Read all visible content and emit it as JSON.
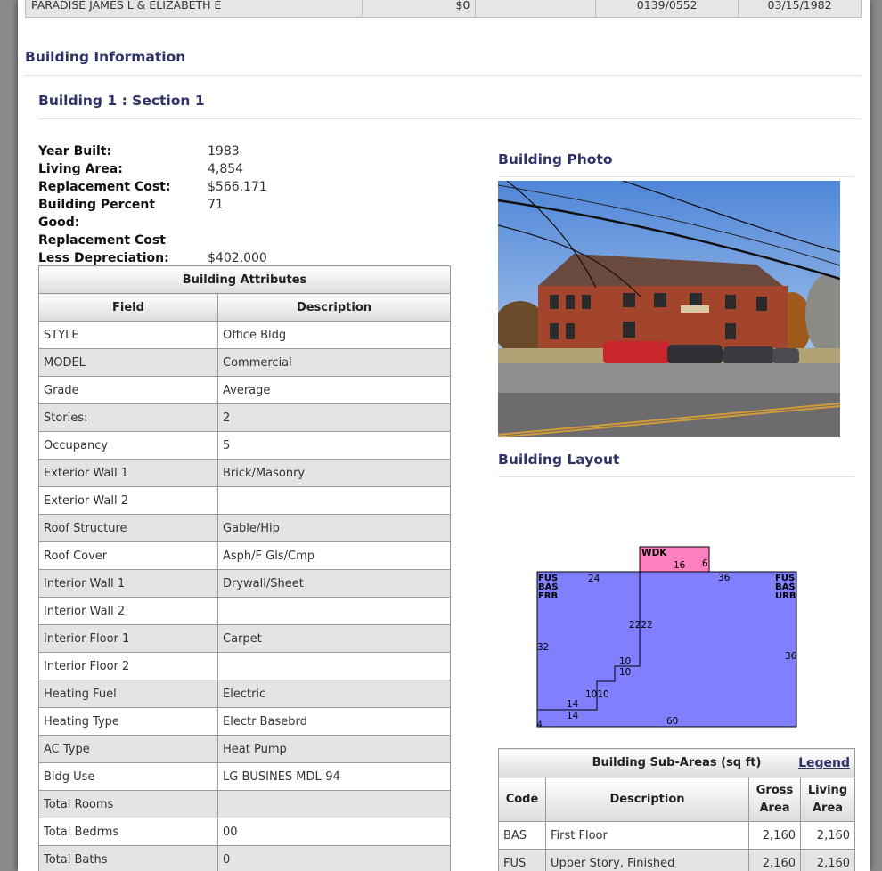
{
  "top_row": {
    "owner": "PARADISE JAMES L & ELIZABETH E",
    "price": "$0",
    "book_page": "0139/0552",
    "date": "03/15/1982"
  },
  "headings": {
    "building_info": "Building Information",
    "section": "Building 1 : Section 1",
    "photo": "Building Photo",
    "layout": "Building Layout"
  },
  "summary": [
    {
      "label": "Year Built:",
      "value": "1983"
    },
    {
      "label": "Living Area:",
      "value": "4,854"
    },
    {
      "label": "Replacement Cost:",
      "value": "$566,171"
    },
    {
      "label": "Building Percent",
      "value": "71"
    },
    {
      "label": "Good:",
      "value": ""
    },
    {
      "label": "Replacement Cost",
      "value": ""
    },
    {
      "label": "Less Depreciation:",
      "value": "$402,000"
    }
  ],
  "attributes": {
    "caption": "Building Attributes",
    "col_field": "Field",
    "col_desc": "Description",
    "rows": [
      {
        "field": "STYLE",
        "desc": "Office Bldg"
      },
      {
        "field": "MODEL",
        "desc": "Commercial"
      },
      {
        "field": "Grade",
        "desc": "Average"
      },
      {
        "field": "Stories:",
        "desc": "2"
      },
      {
        "field": "Occupancy",
        "desc": "5"
      },
      {
        "field": "Exterior Wall 1",
        "desc": "Brick/Masonry"
      },
      {
        "field": "Exterior Wall 2",
        "desc": ""
      },
      {
        "field": "Roof Structure",
        "desc": "Gable/Hip"
      },
      {
        "field": "Roof Cover",
        "desc": "Asph/F Gls/Cmp"
      },
      {
        "field": "Interior Wall 1",
        "desc": "Drywall/Sheet"
      },
      {
        "field": "Interior Wall 2",
        "desc": ""
      },
      {
        "field": "Interior Floor 1",
        "desc": "Carpet"
      },
      {
        "field": "Interior Floor 2",
        "desc": ""
      },
      {
        "field": "Heating Fuel",
        "desc": "Electric"
      },
      {
        "field": "Heating Type",
        "desc": "Electr Basebrd"
      },
      {
        "field": "AC Type",
        "desc": "Heat Pump"
      },
      {
        "field": "Bldg Use",
        "desc": "LG BUSINES MDL-94"
      },
      {
        "field": "Total Rooms",
        "desc": ""
      },
      {
        "field": "Total Bedrms",
        "desc": "00"
      },
      {
        "field": "Total Baths",
        "desc": "0"
      }
    ]
  },
  "layout_sketch": {
    "labels": {
      "wdk": "WDK",
      "left_block": [
        "FUS",
        "BAS",
        "FRB"
      ],
      "right_block": [
        "FUS",
        "BAS",
        "URB"
      ]
    },
    "dimensions": [
      "16",
      "6",
      "24",
      "36",
      "2222",
      "32",
      "36",
      "10",
      "10",
      "1010",
      "14",
      "14",
      "60",
      "4"
    ],
    "colors": {
      "main": "#8080ff",
      "deck": "#ff80c0"
    }
  },
  "sub_areas": {
    "caption": "Building Sub-Areas (sq ft)",
    "legend_link": "Legend",
    "col_code": "Code",
    "col_desc": "Description",
    "col_gross": "Gross Area",
    "col_living": "Living Area",
    "rows": [
      {
        "code": "BAS",
        "desc": "First Floor",
        "gross": "2,160",
        "living": "2,160"
      },
      {
        "code": "FUS",
        "desc": "Upper Story, Finished",
        "gross": "2,160",
        "living": "2,160"
      }
    ]
  },
  "colors": {
    "heading": "#2e3267",
    "row_alt": "#e4e4e4"
  }
}
